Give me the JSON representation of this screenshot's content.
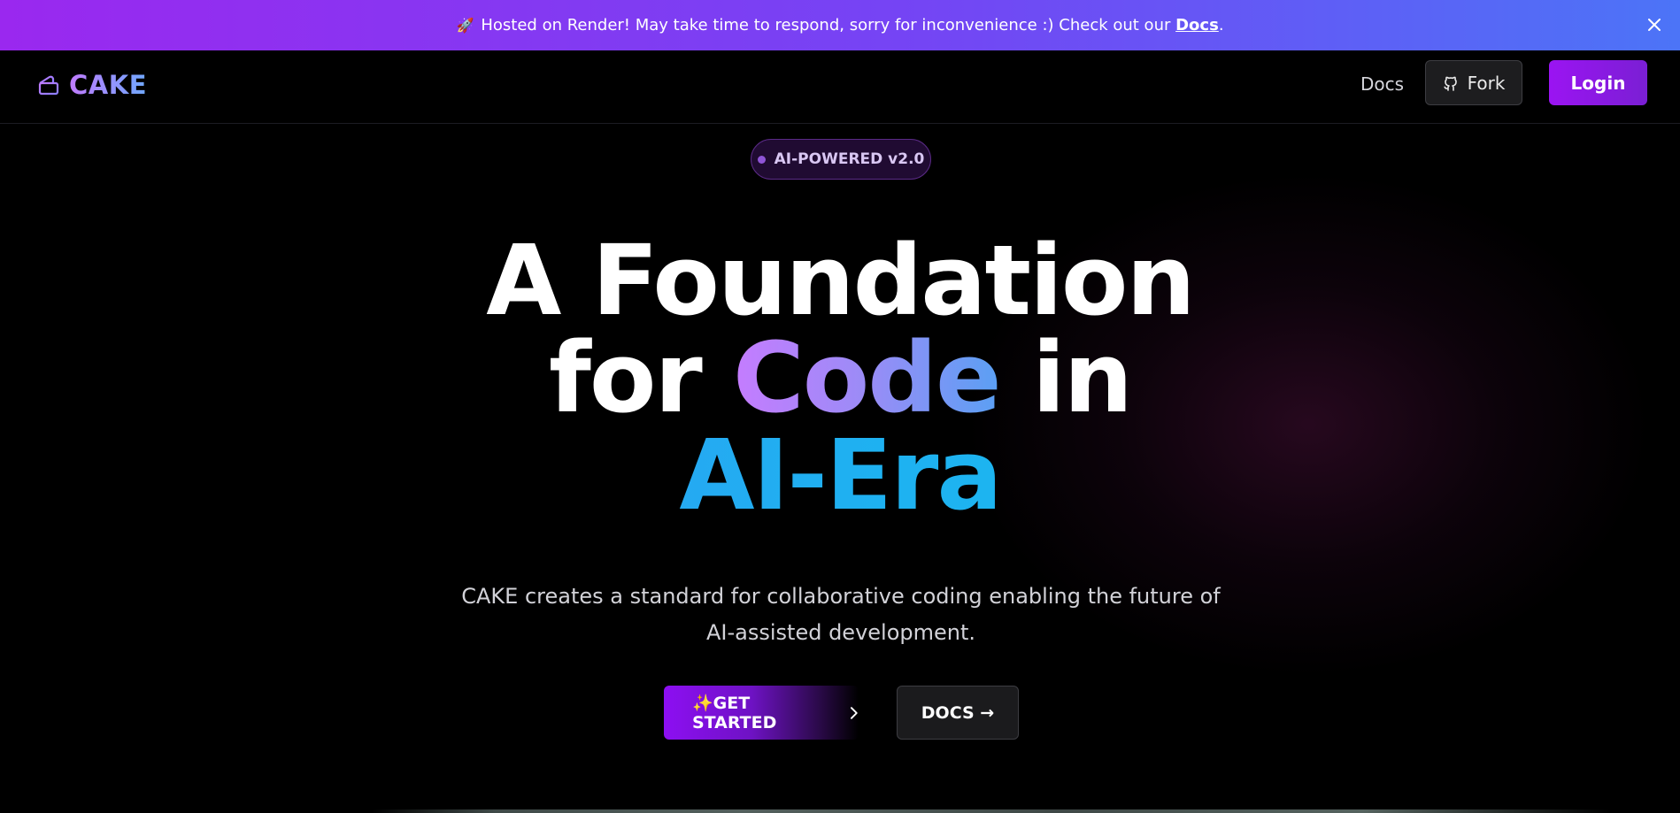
{
  "banner": {
    "emoji": "🚀",
    "text": "Hosted on Render! May take time to respond, sorry for inconvenience :) Check out our ",
    "link_label": "Docs",
    "trailing": ".",
    "close_icon": "close-icon"
  },
  "header": {
    "logo_text": "CAKE",
    "logo_icon": "cake-icon",
    "nav_docs_label": "Docs",
    "fork_label": "Fork",
    "fork_icon": "github-icon",
    "login_label": "Login"
  },
  "hero": {
    "badge": "AI-POWERED v2.0",
    "headline_line1": "A Foundation",
    "headline_for": "for ",
    "headline_code": "Code",
    "headline_in": " in",
    "headline_era": "AI-Era",
    "subtitle": "CAKE creates a standard for collaborative coding enabling the future of AI-assisted development.",
    "cta_start_label": "✨GET STARTED",
    "cta_start_icon": "chevron-right-icon",
    "cta_docs_label": "DOCS →"
  },
  "colors": {
    "accent_purple": "#9b14f2",
    "banner_start": "#9a28ef",
    "banner_end": "#4c74f7",
    "era_blue": "#14c5ee"
  }
}
